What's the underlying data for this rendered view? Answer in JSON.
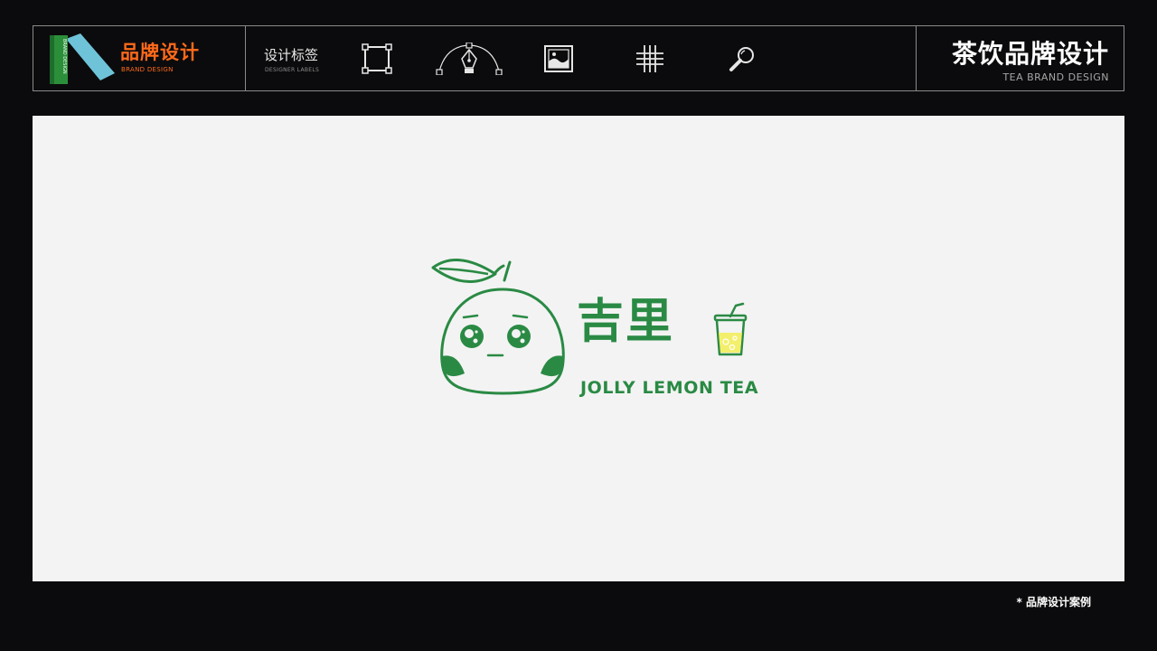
{
  "header": {
    "brand": {
      "title": "品牌设计",
      "subtitle": "BRAND DESIGN",
      "logo_text": "BRAND DESIGN"
    },
    "labels": {
      "title": "设计标签",
      "subtitle": "DESIGNER LABELS"
    },
    "tools": [
      "artboard-icon",
      "pen-tool-icon",
      "image-icon",
      "grid-icon",
      "zoom-icon"
    ],
    "right": {
      "title": "茶饮品牌设计",
      "subtitle": "TEA BRAND DESIGN"
    }
  },
  "logo": {
    "name_cn": "吉里",
    "name_en": "JOLLY LEMON TEA",
    "colors": {
      "primary": "#2a8a44",
      "juice": "#f3ef6c"
    }
  },
  "footer": {
    "note": "* 品牌设计案例"
  },
  "colors": {
    "background": "#0b0b0d",
    "accent": "#ff6a1a",
    "canvas": "#f3f3f3"
  }
}
